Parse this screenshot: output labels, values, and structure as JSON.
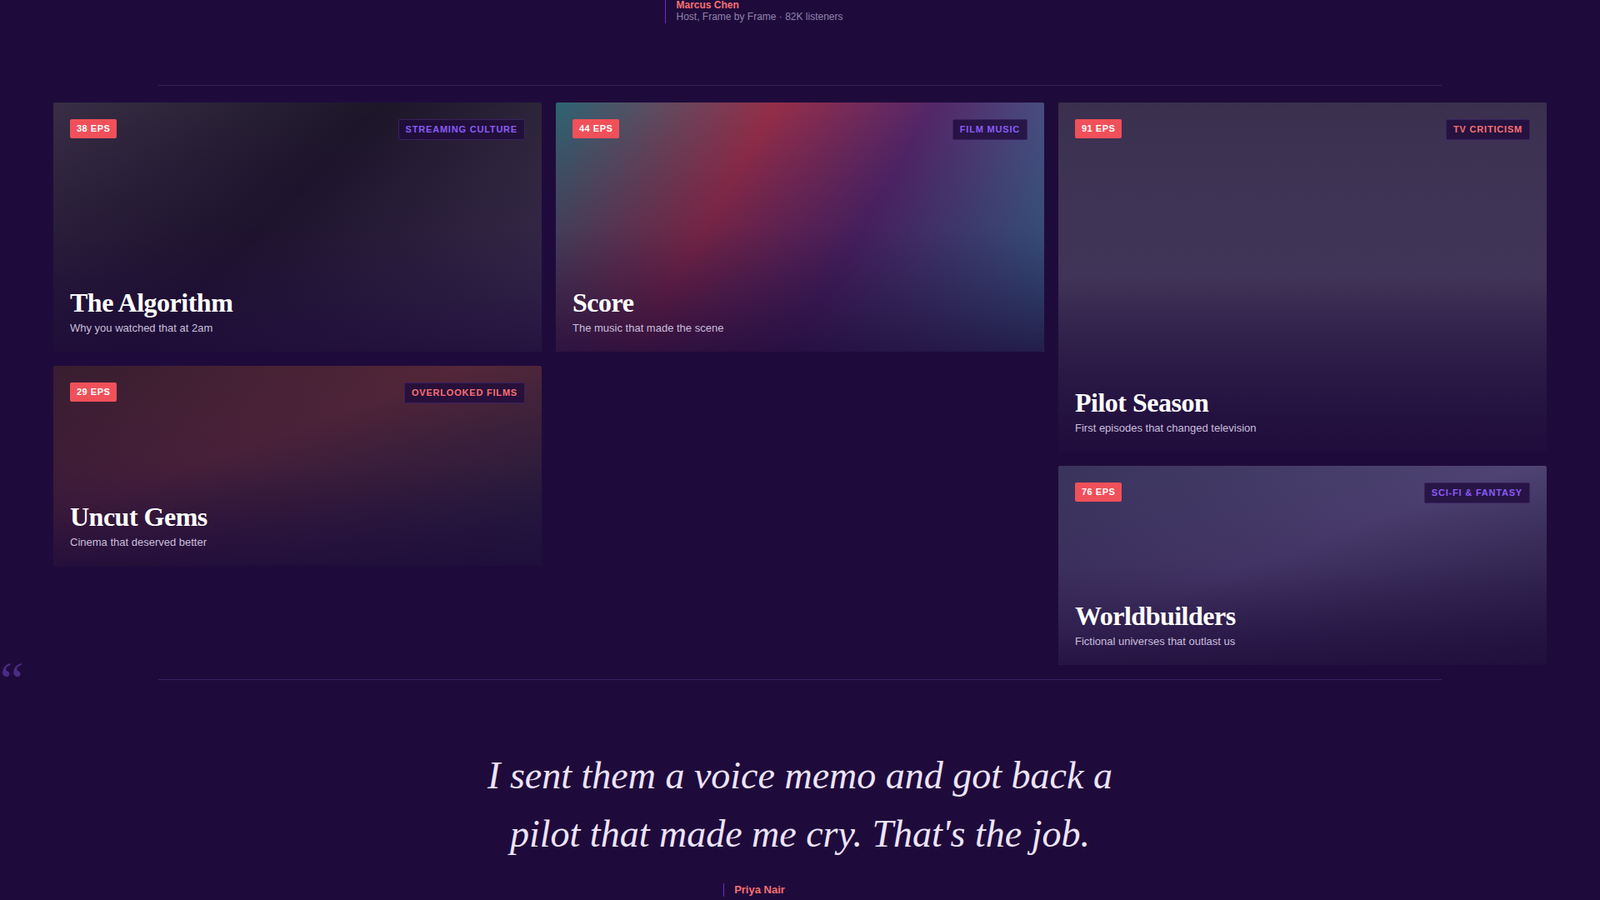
{
  "top_testimonial": {
    "name": "Marcus Chen",
    "role": "Host, Frame by Frame · 82K listeners"
  },
  "shows": [
    {
      "title": "The Algorithm",
      "subtitle": "Why you watched that at 2am",
      "episodes": "38 EPS",
      "tag": "STREAMING CULTURE",
      "color": "#8b5cf6"
    },
    {
      "title": "Score",
      "subtitle": "The music that made the scene",
      "episodes": "44 EPS",
      "tag": "FILM MUSIC",
      "color": "#8b5cf6"
    },
    {
      "title": "Uncut Gems",
      "subtitle": "Cinema that deserved better",
      "episodes": "29 EPS",
      "tag": "OVERLOOKED FILMS",
      "color": "#f87171"
    },
    {
      "title": "Pilot Season",
      "subtitle": "First episodes that changed television",
      "episodes": "91 EPS",
      "tag": "TV CRITICISM",
      "color": "#f87171"
    },
    {
      "title": "Worldbuilders",
      "subtitle": "Fictional universes that outlast us",
      "episodes": "76 EPS",
      "tag": "SCI-FI & FANTASY",
      "color": "#8b5cf6"
    }
  ],
  "quote": {
    "mark": "“",
    "text": "I sent them a voice memo and got back a pilot that made me cry. That's the job.",
    "author": "Priya Nair"
  }
}
